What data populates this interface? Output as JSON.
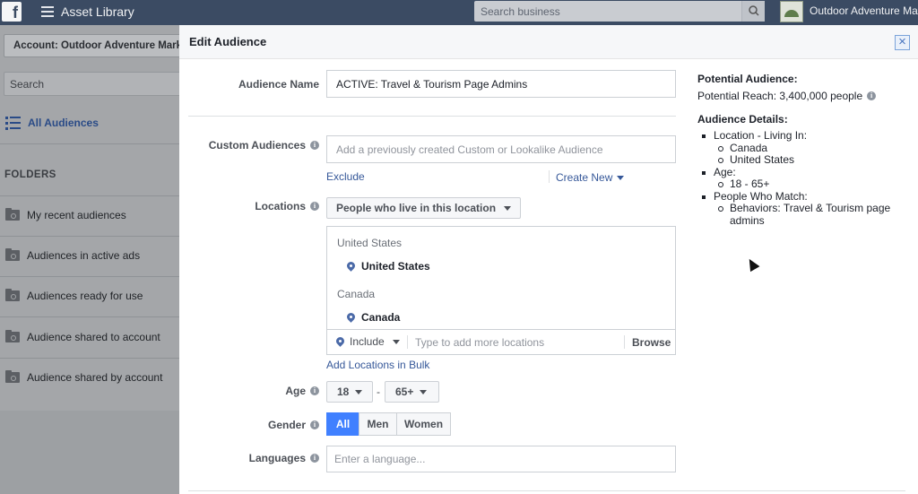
{
  "topbar": {
    "logo_glyph": "f",
    "app_title": "Asset Library",
    "search_placeholder": "Search business",
    "business_name": "Outdoor Adventure Marketing"
  },
  "sidebar": {
    "account_label": "Account: Outdoor Adventure Marketing",
    "search_placeholder": "Search",
    "all_audiences_label": "All Audiences",
    "folders_heading": "FOLDERS",
    "folders": [
      {
        "label": "My recent audiences"
      },
      {
        "label": "Audiences in active ads"
      },
      {
        "label": "Audiences ready for use"
      },
      {
        "label": "Audience shared to account"
      },
      {
        "label": "Audience shared by account"
      }
    ]
  },
  "modal": {
    "title": "Edit Audience",
    "close_glyph": "×",
    "audience_name": {
      "label": "Audience Name",
      "value": "ACTIVE: Travel & Tourism Page Admins"
    },
    "custom_audiences": {
      "label": "Custom Audiences",
      "placeholder": "Add a previously created Custom or Lookalike Audience",
      "exclude_link": "Exclude",
      "create_new_link": "Create New"
    },
    "locations": {
      "label": "Locations",
      "type_dropdown": "People who live in this location",
      "groups": [
        {
          "group": "United States",
          "item": "United States"
        },
        {
          "group": "Canada",
          "item": "Canada"
        }
      ],
      "include_dropdown": "Include",
      "input_placeholder": "Type to add more locations",
      "browse_label": "Browse",
      "bulk_link": "Add Locations in Bulk"
    },
    "age": {
      "label": "Age",
      "min": "18",
      "separator": "-",
      "max": "65+"
    },
    "gender": {
      "label": "Gender",
      "options": [
        "All",
        "Men",
        "Women"
      ],
      "selected": "All"
    },
    "languages": {
      "label": "Languages",
      "placeholder": "Enter a language..."
    }
  },
  "summary": {
    "potential_heading": "Potential Audience:",
    "reach_text": "Potential Reach: 3,400,000 people",
    "details_heading": "Audience Details:",
    "details": [
      {
        "label": "Location - Living In:",
        "sub": [
          "Canada",
          "United States"
        ]
      },
      {
        "label": "Age:",
        "sub": [
          "18 - 65+"
        ]
      },
      {
        "label": "People Who Match:",
        "sub": [
          "Behaviors: Travel & Tourism page admins"
        ]
      }
    ]
  },
  "icons": {
    "info": "info-icon",
    "search": "search-icon",
    "list": "list-icon",
    "folder": "folder-icon",
    "pin": "map-pin-icon"
  },
  "colors": {
    "topbar": "#3b4b63",
    "link": "#365899",
    "accent": "#4080ff",
    "overlay_panel": "#a4a6a9"
  }
}
